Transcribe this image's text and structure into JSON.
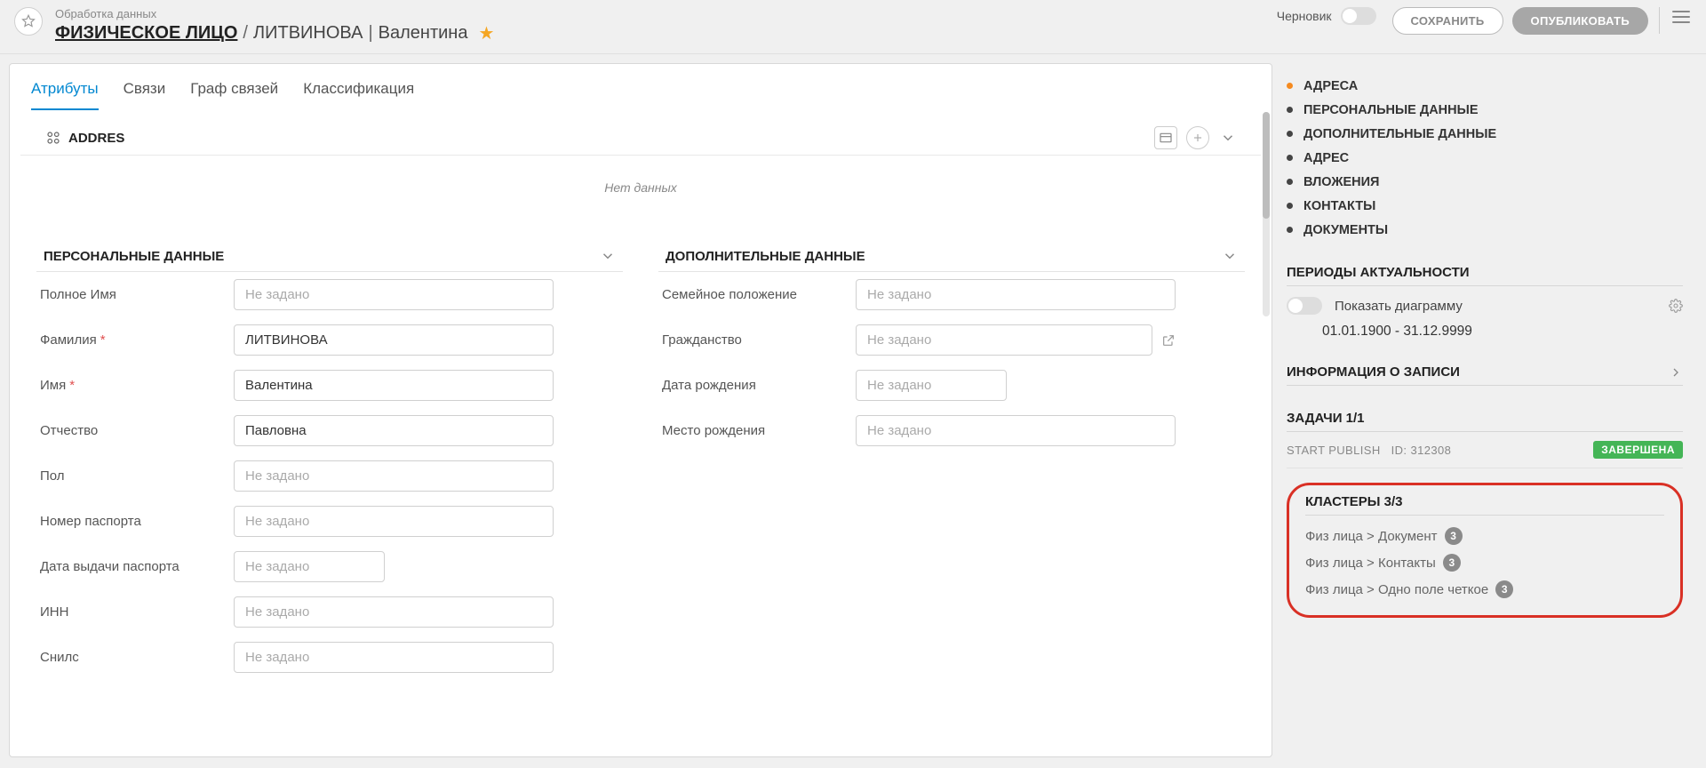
{
  "header": {
    "context": "Обработка данных",
    "entity": "ФИЗИЧЕСКОЕ ЛИЦО",
    "sep1": "/",
    "surname": "ЛИТВИНОВА",
    "sep2": "|",
    "firstname": "Валентина",
    "draft_label": "Черновик",
    "save_label": "СОХРАНИТЬ",
    "publish_label": "ОПУБЛИКОВАТЬ"
  },
  "tabs": [
    "Атрибуты",
    "Связи",
    "Граф связей",
    "Классификация"
  ],
  "addres_section": {
    "title": "ADDRES",
    "nodata": "Нет данных"
  },
  "personal": {
    "title": "ПЕРСОНАЛЬНЫЕ ДАННЫЕ",
    "fields": {
      "fullname_label": "Полное Имя",
      "surname_label": "Фамилия",
      "firstname_label": "Имя",
      "patronymic_label": "Отчество",
      "gender_label": "Пол",
      "passport_label": "Номер паспорта",
      "passport_date_label": "Дата выдачи паспорта",
      "inn_label": "ИНН",
      "snils_label": "Снилс"
    },
    "values": {
      "surname": "ЛИТВИНОВА",
      "firstname": "Валентина",
      "patronymic": "Павловна"
    },
    "placeholder": "Не задано"
  },
  "additional": {
    "title": "ДОПОЛНИТЕЛЬНЫЕ ДАННЫЕ",
    "fields": {
      "marital_label": "Семейное положение",
      "citizenship_label": "Гражданство",
      "dob_label": "Дата рождения",
      "birthplace_label": "Место рождения"
    },
    "placeholder": "Не задано"
  },
  "nav": {
    "items": [
      "АДРЕСА",
      "ПЕРСОНАЛЬНЫЕ ДАННЫЕ",
      "ДОПОЛНИТЕЛЬНЫЕ ДАННЫЕ",
      "АДРЕС",
      "ВЛОЖЕНИЯ",
      "КОНТАКТЫ",
      "ДОКУМЕНТЫ"
    ]
  },
  "periods": {
    "title": "ПЕРИОДЫ АКТУАЛЬНОСТИ",
    "show_diagram": "Показать диаграмму",
    "range": "01.01.1900 - 31.12.9999"
  },
  "record_info": {
    "title": "ИНФОРМАЦИЯ О ЗАПИСИ"
  },
  "tasks": {
    "title": "ЗАДАЧИ 1/1",
    "action": "START PUBLISH",
    "id_label": "ID: 312308",
    "status": "ЗАВЕРШЕНА"
  },
  "clusters": {
    "title": "КЛАСТЕРЫ 3/3",
    "items": [
      {
        "label": "Физ лица > Документ",
        "count": "3"
      },
      {
        "label": "Физ лица > Контакты",
        "count": "3"
      },
      {
        "label": "Физ лица > Одно поле четкое",
        "count": "3"
      }
    ]
  }
}
